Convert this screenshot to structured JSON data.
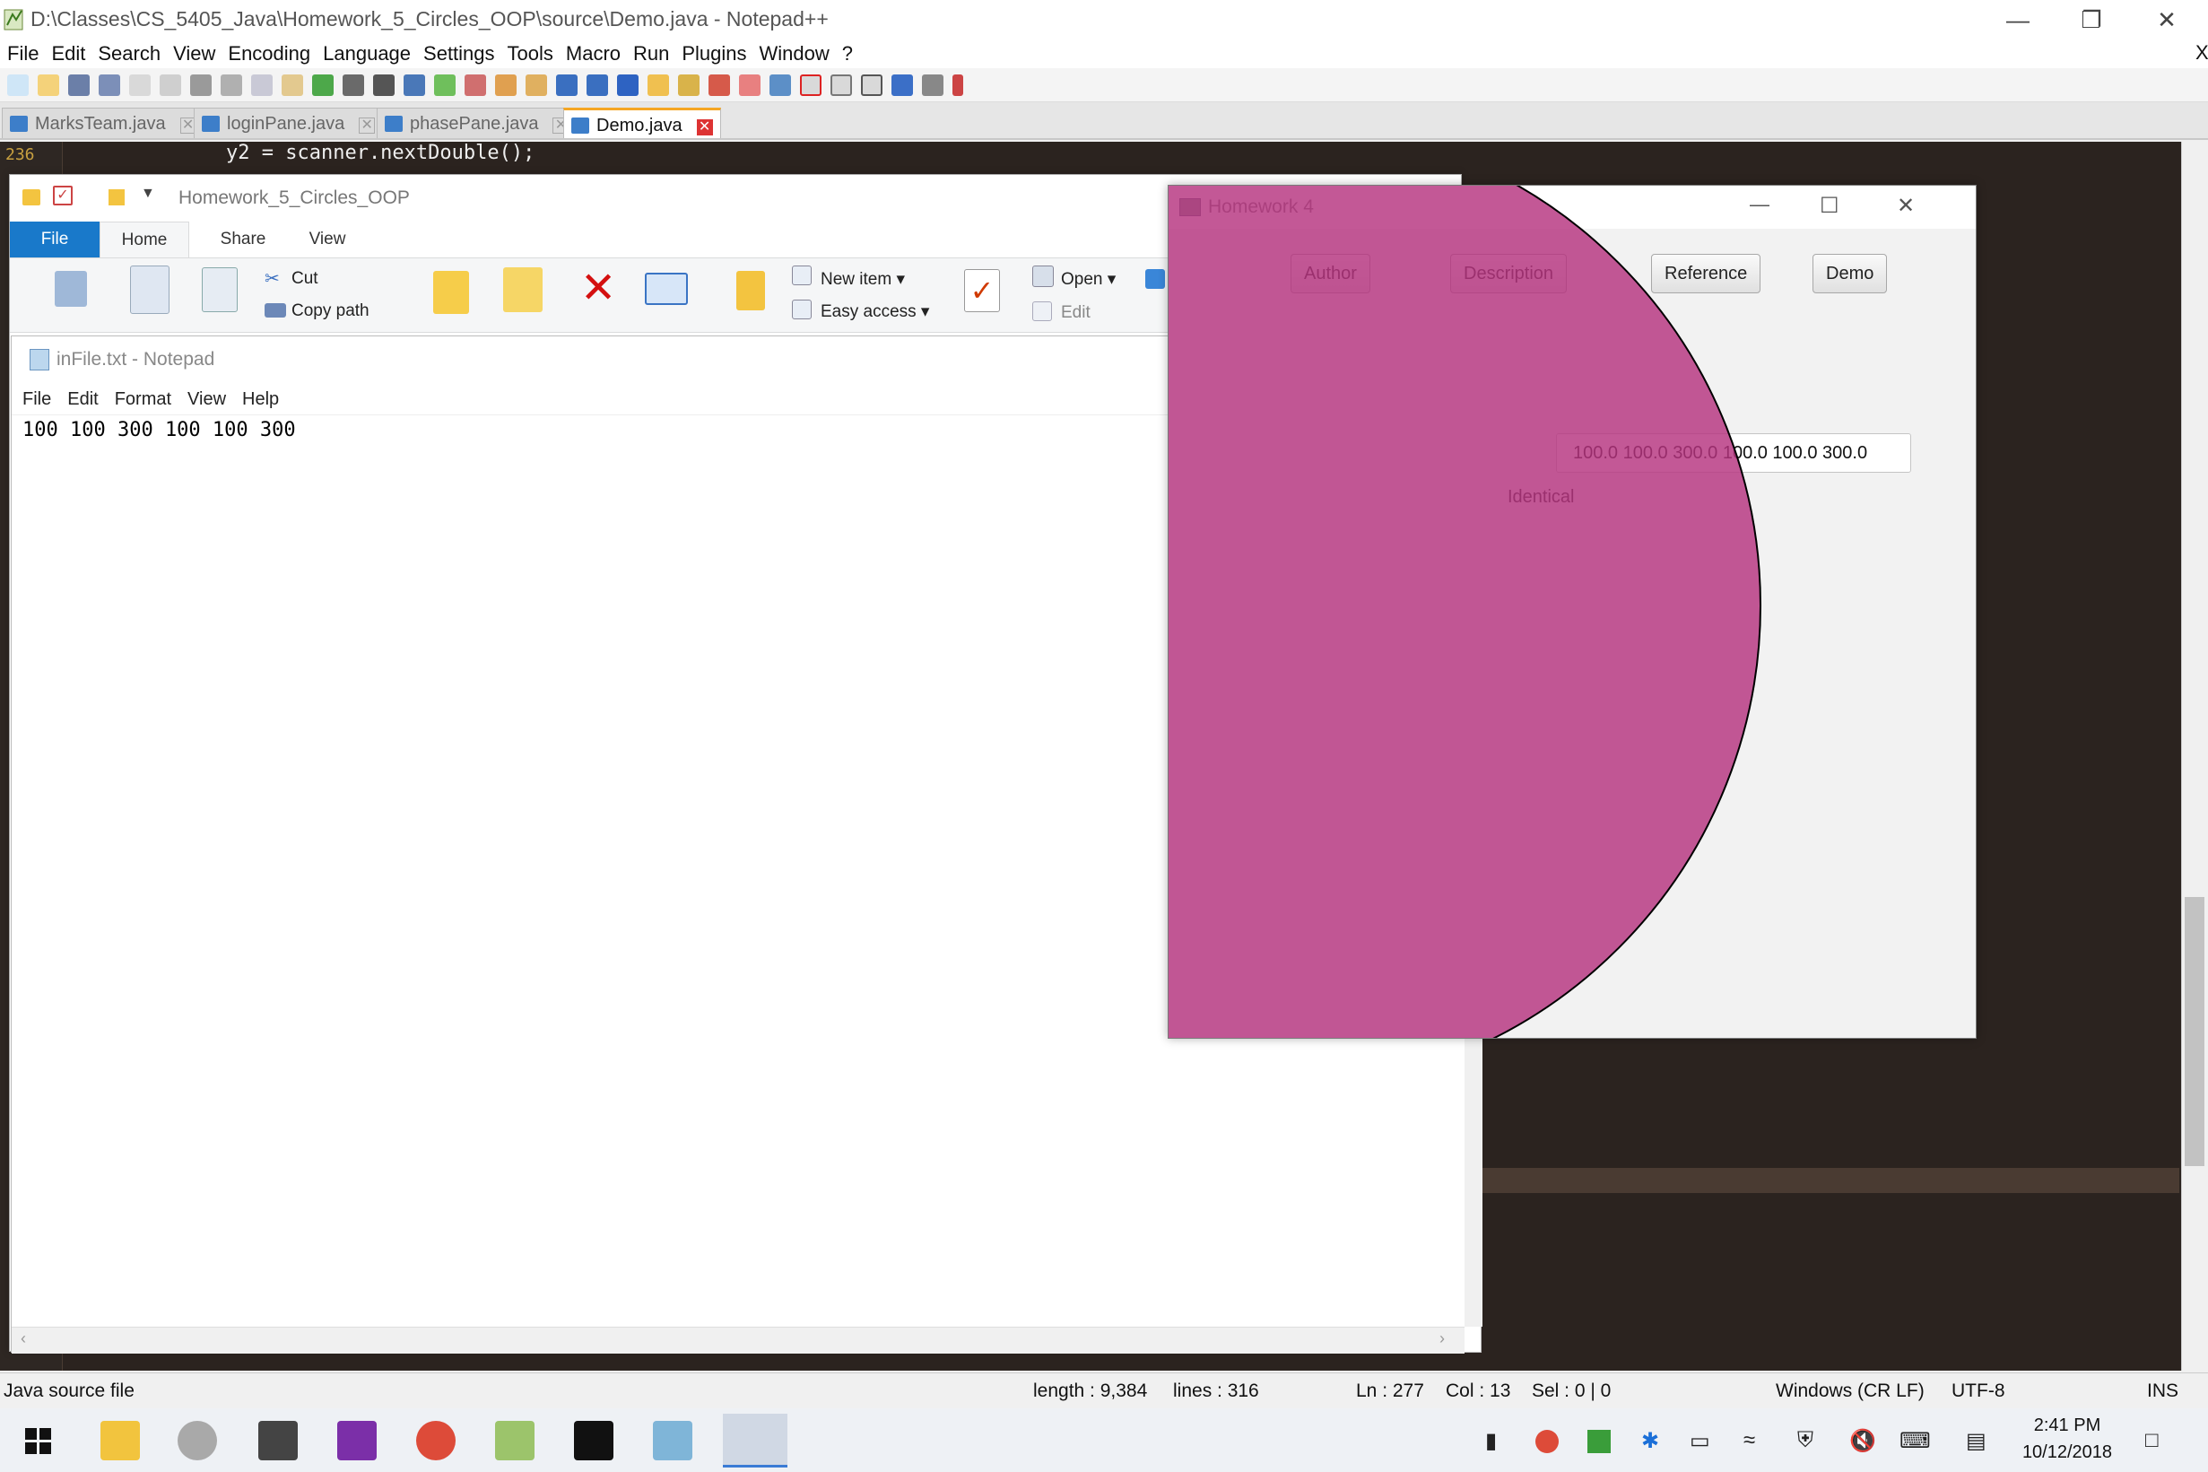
{
  "npp": {
    "title": "D:\\Classes\\CS_5405_Java\\Homework_5_Circles_OOP\\source\\Demo.java - Notepad++",
    "menu": [
      "File",
      "Edit",
      "Search",
      "View",
      "Encoding",
      "Language",
      "Settings",
      "Tools",
      "Macro",
      "Run",
      "Plugins",
      "Window",
      "?"
    ],
    "close_x": "X",
    "tabs": [
      {
        "label": "MarksTeam.java"
      },
      {
        "label": "loginPane.java"
      },
      {
        "label": "phasePane.java"
      },
      {
        "label": "Demo.java"
      }
    ],
    "code_line": "y2 = scanner.nextDouble();",
    "line_number": "236",
    "status": {
      "file_type": "Java source file",
      "length": "length : 9,384",
      "lines": "lines : 316",
      "ln": "Ln : 277",
      "col": "Col : 13",
      "sel": "Sel : 0 | 0",
      "eol": "Windows (CR LF)",
      "encoding": "UTF-8",
      "mode": "INS"
    }
  },
  "explorer": {
    "title": "Homework_5_Circles_OOP",
    "tabs": [
      "File",
      "Home",
      "Share",
      "View"
    ],
    "ribbon": {
      "cut": "Cut",
      "copy_path": "Copy path",
      "new_item": "New item",
      "easy_access": "Easy access",
      "open": "Open",
      "edit": "Edit"
    }
  },
  "notepad": {
    "title": "inFile.txt - Notepad",
    "menu": [
      "File",
      "Edit",
      "Format",
      "View",
      "Help"
    ],
    "content": "100 100 300 100 100 300"
  },
  "fx": {
    "title": "Homework 4",
    "buttons": [
      "Author",
      "Description",
      "Reference",
      "Demo"
    ],
    "input_value": "100.0 100.0 300.0 100.0 100.0 300.0",
    "result_label": "Identical",
    "circle_color": "#b6337f"
  },
  "taskbar": {
    "time": "2:41 PM",
    "date": "10/12/2018"
  }
}
